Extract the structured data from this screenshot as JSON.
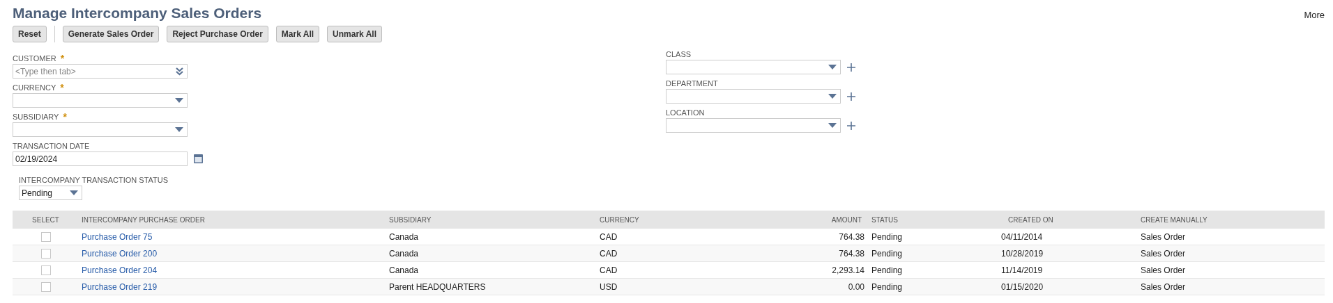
{
  "page": {
    "title": "Manage Intercompany Sales Orders",
    "more": "More"
  },
  "toolbar": [
    {
      "label": "Reset",
      "separator_after": true
    },
    {
      "label": "Generate Sales Order",
      "separator_after": false
    },
    {
      "label": "Reject Purchase Order",
      "separator_after": false
    },
    {
      "label": "Mark All",
      "separator_after": false
    },
    {
      "label": "Unmark All",
      "separator_after": false
    }
  ],
  "left_fields": [
    {
      "kind": "autocomplete",
      "label": "CUSTOMER",
      "required_mark": "*",
      "placeholder": "<Type then tab>",
      "addable": false
    },
    {
      "kind": "select",
      "label": "CURRENCY",
      "required_mark": "*",
      "addable": false
    },
    {
      "kind": "select",
      "label": "SUBSIDIARY",
      "required_mark": "*",
      "addable": false
    },
    {
      "kind": "date",
      "label": "TRANSACTION DATE",
      "value": "02/19/2024",
      "addable": false
    }
  ],
  "right_fields": [
    {
      "kind": "select",
      "label": "CLASS",
      "addable": true
    },
    {
      "kind": "select",
      "label": "DEPARTMENT",
      "addable": true
    },
    {
      "kind": "select",
      "label": "LOCATION",
      "addable": true
    }
  ],
  "status_filter": {
    "label": "INTERCOMPANY TRANSACTION STATUS",
    "value": "Pending"
  },
  "table": {
    "columns": [
      "SELECT",
      "INTERCOMPANY PURCHASE ORDER",
      "SUBSIDIARY",
      "CURRENCY",
      "AMOUNT",
      "STATUS",
      "CREATED ON",
      "CREATE MANUALLY"
    ],
    "rows": [
      {
        "checked": false,
        "order": "Purchase Order 75",
        "subsidiary": "Canada",
        "currency": "CAD",
        "amount": "764.38",
        "status": "Pending",
        "created_on": "04/11/2014",
        "create_manually": "Sales Order"
      },
      {
        "checked": false,
        "order": "Purchase Order 200",
        "subsidiary": "Canada",
        "currency": "CAD",
        "amount": "764.38",
        "status": "Pending",
        "created_on": "10/28/2019",
        "create_manually": "Sales Order"
      },
      {
        "checked": false,
        "order": "Purchase Order 204",
        "subsidiary": "Canada",
        "currency": "CAD",
        "amount": "2,293.14",
        "status": "Pending",
        "created_on": "11/14/2019",
        "create_manually": "Sales Order"
      },
      {
        "checked": false,
        "order": "Purchase Order 219",
        "subsidiary": "Parent HEADQUARTERS",
        "currency": "USD",
        "amount": "0.00",
        "status": "Pending",
        "created_on": "01/15/2020",
        "create_manually": "Sales Order"
      }
    ]
  }
}
